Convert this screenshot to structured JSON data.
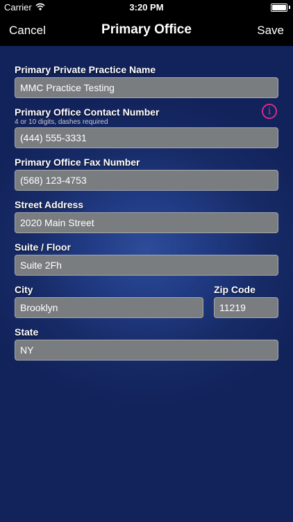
{
  "status_bar": {
    "carrier": "Carrier",
    "wifi_icon": "wifi-icon",
    "time": "3:20 PM",
    "battery_icon": "battery-icon"
  },
  "nav": {
    "cancel_label": "Cancel",
    "title": "Primary Office",
    "save_label": "Save"
  },
  "form": {
    "practice_name": {
      "label": "Primary Private Practice Name",
      "value": "MMC Practice Testing"
    },
    "contact_number": {
      "label": "Primary Office Contact Number",
      "hint": "4 or 10 digits, dashes required",
      "value": "(444) 555-3331",
      "info_icon": "info-icon"
    },
    "fax_number": {
      "label": "Primary Office Fax Number",
      "value": "(568) 123-4753"
    },
    "street_address": {
      "label": "Street Address",
      "value": "2020 Main Street"
    },
    "suite_floor": {
      "label": "Suite / Floor",
      "value": "Suite 2Fh"
    },
    "city": {
      "label": "City",
      "value": "Brooklyn"
    },
    "zip_code": {
      "label": "Zip Code",
      "value": "11219"
    },
    "state": {
      "label": "State",
      "value": "NY"
    }
  },
  "colors": {
    "background": "#1a2f6e",
    "field_background": "#7a7d80",
    "info_accent": "#d22d8d"
  }
}
